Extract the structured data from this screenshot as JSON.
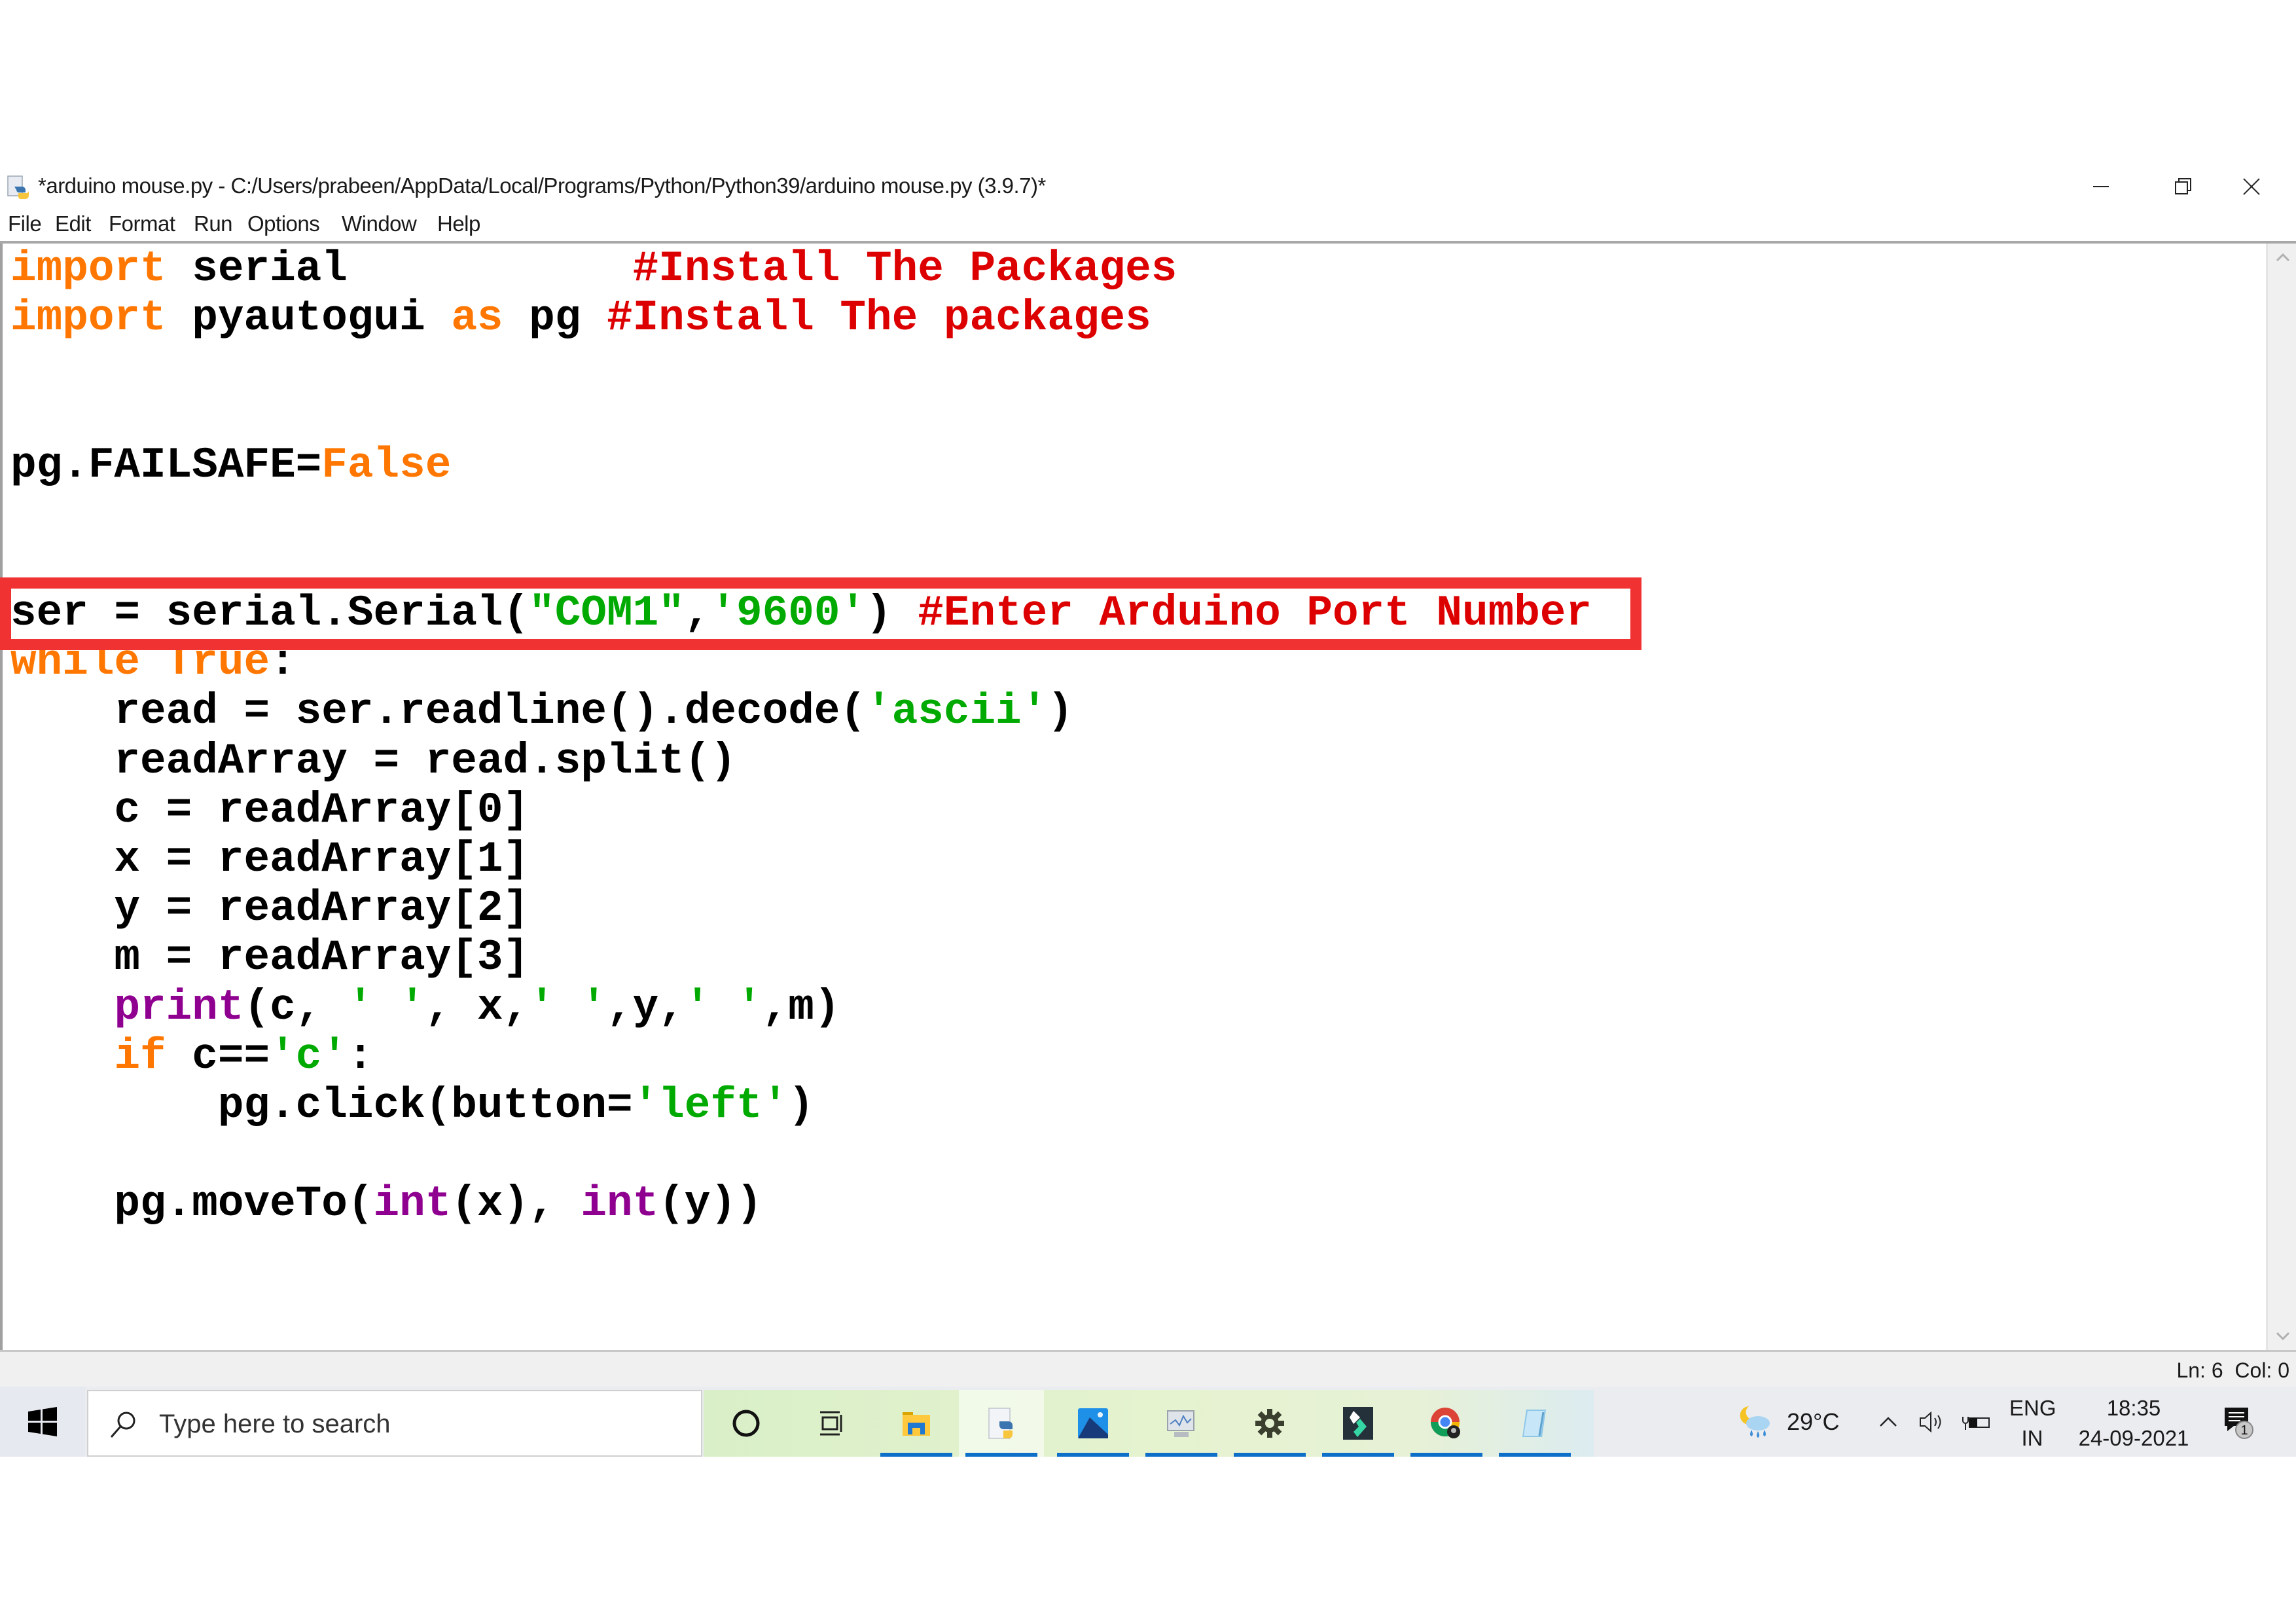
{
  "window": {
    "title": "*arduino mouse.py - C:/Users/prabeen/AppData/Local/Programs/Python/Python39/arduino mouse.py (3.9.7)*",
    "icon": "python-idle-icon",
    "controls": [
      "minimize-icon",
      "restore-icon",
      "close-icon"
    ]
  },
  "menu": [
    "File",
    "Edit",
    "Format",
    "Run",
    "Options",
    "Window",
    "Help"
  ],
  "editor": {
    "highlighted_line_index": 7,
    "highlight_color": "#f03232",
    "syntax_colors": {
      "keyword": "#ff7700",
      "comment": "#dd0000",
      "string": "#00aa00",
      "builtin": "#900090",
      "default": "#000000"
    },
    "lines": [
      [
        {
          "t": "import",
          "c": "kw"
        },
        {
          "t": " serial           "
        },
        {
          "t": "#Install The Packages",
          "c": "cm"
        }
      ],
      [
        {
          "t": "import",
          "c": "kw"
        },
        {
          "t": " pyautogui "
        },
        {
          "t": "as",
          "c": "kw"
        },
        {
          "t": " pg "
        },
        {
          "t": "#Install The packages",
          "c": "cm"
        }
      ],
      [],
      [],
      [
        {
          "t": "pg.FAILSAFE="
        },
        {
          "t": "False",
          "c": "kw"
        }
      ],
      [],
      [],
      [
        {
          "t": "ser = serial.Serial("
        },
        {
          "t": "\"COM1\"",
          "c": "st"
        },
        {
          "t": ","
        },
        {
          "t": "'9600'",
          "c": "st"
        },
        {
          "t": ") "
        },
        {
          "t": "#Enter Arduino Port Number",
          "c": "cm"
        }
      ],
      [
        {
          "t": "while",
          "c": "kw"
        },
        {
          "t": " "
        },
        {
          "t": "True",
          "c": "kw"
        },
        {
          "t": ":"
        }
      ],
      [
        {
          "t": "    read = ser.readline().decode("
        },
        {
          "t": "'ascii'",
          "c": "st"
        },
        {
          "t": ")"
        }
      ],
      [
        {
          "t": "    readArray = read.split()"
        }
      ],
      [
        {
          "t": "    c = readArray[0]"
        }
      ],
      [
        {
          "t": "    x = readArray[1]"
        }
      ],
      [
        {
          "t": "    y = readArray[2]"
        }
      ],
      [
        {
          "t": "    m = readArray[3]"
        }
      ],
      [
        {
          "t": "    "
        },
        {
          "t": "print",
          "c": "bi"
        },
        {
          "t": "(c, "
        },
        {
          "t": "' '",
          "c": "st"
        },
        {
          "t": ", x,"
        },
        {
          "t": "' '",
          "c": "st"
        },
        {
          "t": ",y,"
        },
        {
          "t": "' '",
          "c": "st"
        },
        {
          "t": ",m)"
        }
      ],
      [
        {
          "t": "    "
        },
        {
          "t": "if",
          "c": "kw"
        },
        {
          "t": " c=="
        },
        {
          "t": "'c'",
          "c": "st"
        },
        {
          "t": ":"
        }
      ],
      [
        {
          "t": "        pg.click(button="
        },
        {
          "t": "'left'",
          "c": "st"
        },
        {
          "t": ")"
        }
      ],
      [],
      [
        {
          "t": "    pg.moveTo("
        },
        {
          "t": "int",
          "c": "bi"
        },
        {
          "t": "(x), "
        },
        {
          "t": "int",
          "c": "bi"
        },
        {
          "t": "(y))"
        }
      ]
    ]
  },
  "status": {
    "line": "Ln: 6",
    "col": "Col: 0"
  },
  "taskbar": {
    "search_placeholder": "Type here to search",
    "apps": [
      {
        "name": "cortana",
        "icon": "cortana-circle-icon",
        "running": false
      },
      {
        "name": "task-view",
        "icon": "task-view-icon",
        "running": false
      },
      {
        "name": "file-explorer",
        "icon": "folder-icon",
        "running": true
      },
      {
        "name": "python-idle",
        "icon": "python-file-icon",
        "running": true,
        "active": true
      },
      {
        "name": "photos",
        "icon": "photos-icon",
        "running": true
      },
      {
        "name": "performance-monitor",
        "icon": "monitor-chart-icon",
        "running": true
      },
      {
        "name": "settings",
        "icon": "gear-icon",
        "running": true
      },
      {
        "name": "filmora",
        "icon": "filmora-icon",
        "running": true
      },
      {
        "name": "chrome",
        "icon": "chrome-icon",
        "running": true
      },
      {
        "name": "notepad",
        "icon": "notepad-icon",
        "running": true
      }
    ],
    "weather": {
      "temp": "29°C",
      "icon": "weather-rain-night-icon"
    },
    "tray_icons": [
      "chevron-up-icon",
      "speaker-icon",
      "battery-charging-icon"
    ],
    "language": {
      "line1": "ENG",
      "line2": "IN"
    },
    "clock": {
      "time": "18:35",
      "date": "24-09-2021"
    },
    "notifications": {
      "count": "1"
    }
  }
}
